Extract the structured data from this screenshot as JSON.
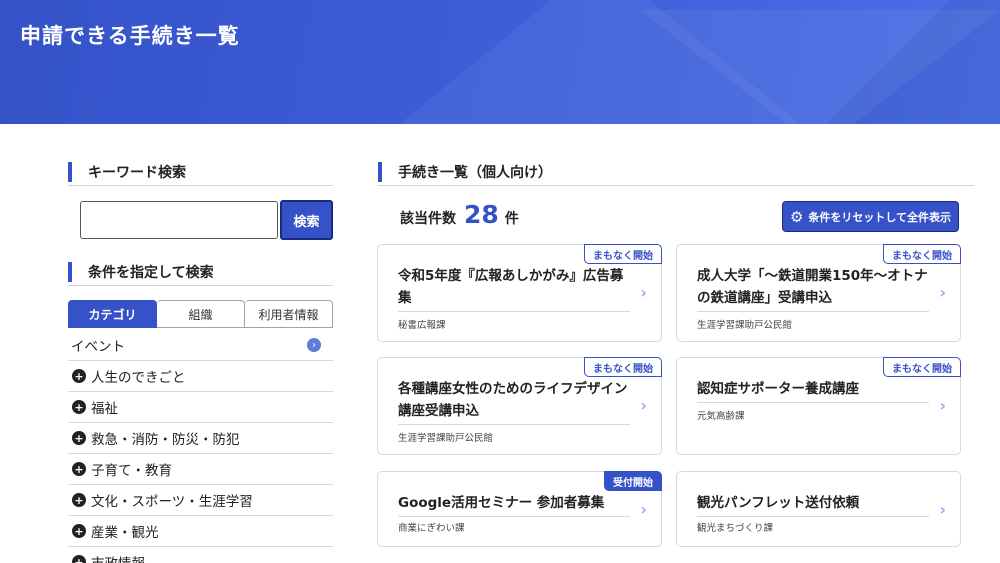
{
  "page": {
    "title": "申請できる手続き一覧"
  },
  "sidebar": {
    "keyword_heading": "キーワード検索",
    "search": {
      "value": "",
      "placeholder": "",
      "button_label": "検索"
    },
    "filter_heading": "条件を指定して検索",
    "tabs": [
      {
        "label": "カテゴリ",
        "active": true
      },
      {
        "label": "組織",
        "active": false
      },
      {
        "label": "利用者情報",
        "active": false
      }
    ],
    "categories": [
      {
        "label": "イベント"
      },
      {
        "label": "人生のできごと"
      },
      {
        "label": "福祉"
      },
      {
        "label": "救急・消防・防災・防犯"
      },
      {
        "label": "子育て・教育"
      },
      {
        "label": "文化・スポーツ・生涯学習"
      },
      {
        "label": "産業・観光"
      },
      {
        "label": "市政情報"
      }
    ]
  },
  "main": {
    "heading": "手続き一覧（個人向け）",
    "count_label": "該当件数",
    "count_value": "28",
    "count_unit": "件",
    "reset_label": "条件をリセットして全件表示",
    "cards": [
      {
        "badge": "まもなく開始",
        "title": "令和5年度『広報あしかがみ』広告募集",
        "dept": "秘書広報課"
      },
      {
        "badge": "まもなく開始",
        "title": "成人大学「～鉄道開業150年～オトナの鉄道講座」受講申込",
        "dept": "生涯学習課助戸公民館"
      },
      {
        "badge": "まもなく開始",
        "title": "各種講座女性のためのライフデザイン講座受講申込",
        "dept": "生涯学習課助戸公民館"
      },
      {
        "badge": "まもなく開始",
        "title": "認知症サポーター養成講座",
        "dept": "元気高齢課"
      },
      {
        "badge": "受付開始",
        "title": "Google活用セミナー 参加者募集",
        "dept": "商業にぎわい課"
      },
      {
        "badge": "",
        "title": "観光パンフレット送付依頼",
        "dept": "観光まちづくり課"
      }
    ]
  },
  "colors": {
    "brand": "#3552c8",
    "badge_accent": "#3552c8",
    "chevron": "#8fb0ea"
  }
}
